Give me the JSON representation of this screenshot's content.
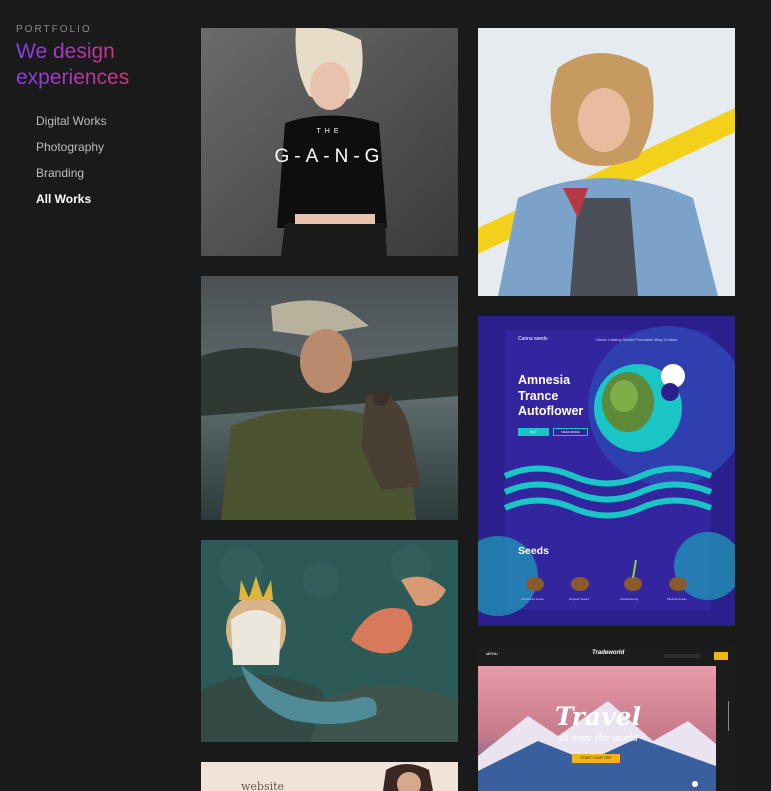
{
  "sidebar": {
    "eyebrow": "PORTFOLIO",
    "headline_line1": "We design",
    "headline_line2": "experiences",
    "nav": [
      {
        "label": "Digital Works",
        "active": false
      },
      {
        "label": "Photography",
        "active": false
      },
      {
        "label": "Branding",
        "active": false
      },
      {
        "label": "All Works",
        "active": true
      }
    ]
  },
  "tiles": {
    "gang": {
      "the": "THE",
      "title": "G-A-N-G"
    },
    "amnesia": {
      "logo": "Canna seeds",
      "nav": "Home Catalog Seeds Promotion Blog Contact",
      "title_line1": "Amnesia",
      "title_line2": "Trance",
      "title_line3": "Autoflower",
      "btn_buy": "BUY",
      "btn_read": "READ MORE",
      "seeds": "Seeds",
      "seed_labels": [
        "Feminized seeds",
        "Regular Seeds",
        "Autoflowering",
        "Medical Seeds"
      ]
    },
    "travel": {
      "menu": "MENU",
      "brand": "Tradeworld",
      "title": "Travel",
      "subtitle": "all over the world",
      "btn": "START YOUR TRIP"
    },
    "website": {
      "word": "website"
    }
  },
  "colors": {
    "background": "#1a1a1a",
    "headline_gradient_start": "#8a3cf0",
    "headline_gradient_end": "#e5333f",
    "amnesia_bg": "#2a1f8c",
    "amnesia_accent": "#1ac5c5",
    "travel_accent": "#f2b413"
  }
}
